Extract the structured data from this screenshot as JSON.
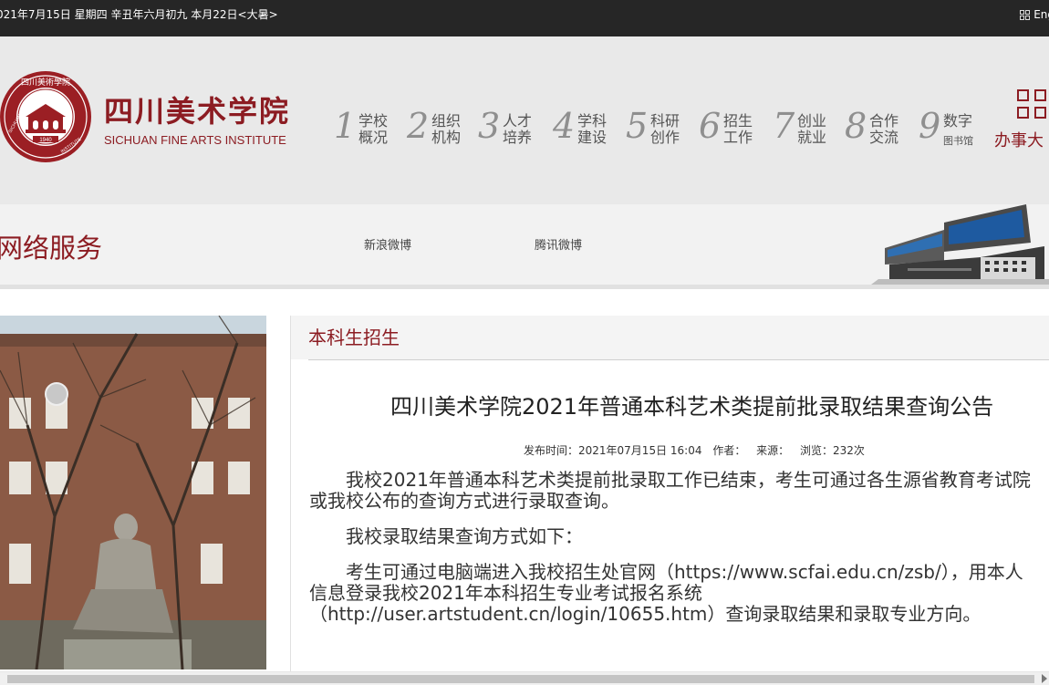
{
  "topbar": {
    "date_text": "021年7月15日  星期四  辛丑年六月初九  本月22日<大暑>",
    "lang_label": "Eng"
  },
  "header": {
    "brand_cn": "四川美术学院",
    "brand_en": "SICHUAN FINE ARTS INSTITUTE",
    "seal": {
      "ring_text": "四川美术学院 SICHUAN FINE ARTS INSTITUTE",
      "year": "1940"
    },
    "nav": [
      {
        "num": "1",
        "line1": "学校",
        "line2": "概况"
      },
      {
        "num": "2",
        "line1": "组织",
        "line2": "机构"
      },
      {
        "num": "3",
        "line1": "人才",
        "line2": "培养"
      },
      {
        "num": "4",
        "line1": "学科",
        "line2": "建设"
      },
      {
        "num": "5",
        "line1": "科研",
        "line2": "创作"
      },
      {
        "num": "6",
        "line1": "招生",
        "line2": "工作"
      },
      {
        "num": "7",
        "line1": "创业",
        "line2": "就业"
      },
      {
        "num": "8",
        "line1": "合作",
        "line2": "交流"
      },
      {
        "num": "9",
        "line1": "数字",
        "line2": "图书馆"
      }
    ],
    "office_label": "办事大",
    "office_icon": "grid-icon"
  },
  "banner": {
    "title": "网络服务",
    "links": [
      "新浪微博",
      "腾讯微博"
    ]
  },
  "content": {
    "section_title": "本科生招生",
    "article_title": "四川美术学院2021年普通本科艺术类提前批录取结果查询公告",
    "meta": {
      "publish": "发布时间：2021年07月15日 16:04",
      "author": "作者：",
      "source": "来源：",
      "views": "浏览：232次"
    },
    "paragraphs": [
      "　　我校2021年普通本科艺术类提前批录取工作已结束，考生可通过各生源省教育考试院",
      "或我校公布的查询方式进行录取查询。",
      "　　我校录取结果查询方式如下：",
      "　　考生可通过电脑端进入我校招生处官网（https://www.scfai.edu.cn/zsb/），用本人",
      "信息登录我校2021年本科招生专业考试报名系统",
      "（http://user.artstudent.cn/login/10655.htm）查询录取结果和录取专业方向。"
    ]
  },
  "colors": {
    "brand": "#8c1c22",
    "topbar": "#262626",
    "header_bg": "#e9e9e9"
  }
}
